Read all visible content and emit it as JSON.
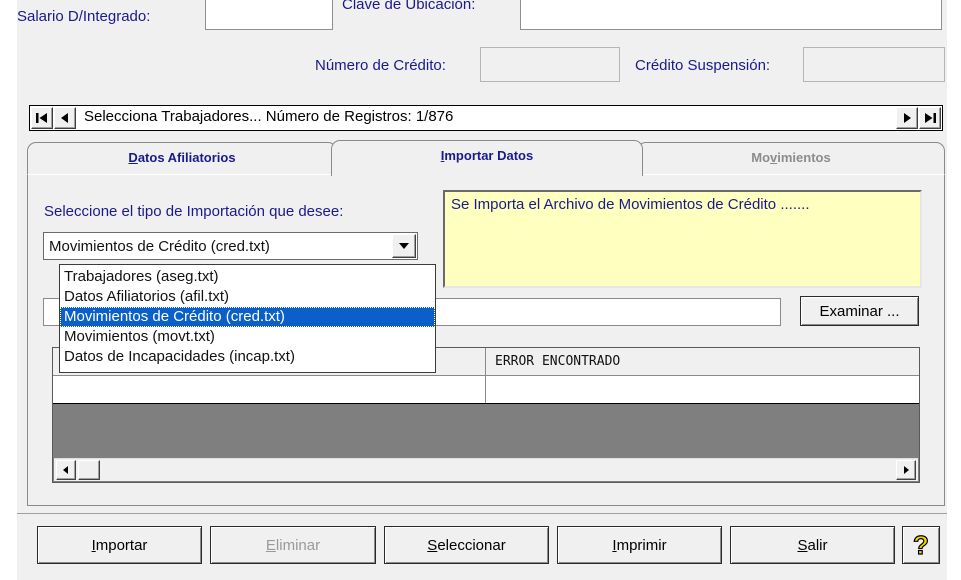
{
  "top_fields": {
    "salario_label": "Salario D/Integrado:",
    "clave_label": "Clave de Ubicación:",
    "numero_credito_label": "Número de Crédito:",
    "credito_suspension_label": "Crédito Suspensión:"
  },
  "navigator": {
    "text": "Selecciona Trabajadores... Número de Registros:  1/876",
    "first_icon": "first-record-icon",
    "prev_icon": "prev-record-icon",
    "next_icon": "next-record-icon",
    "last_icon": "last-record-icon"
  },
  "tabs": [
    {
      "pre": "",
      "ul": "D",
      "post": "atos Afiliatorios",
      "state": "normal"
    },
    {
      "pre": "",
      "ul": "I",
      "post": "mportar Datos",
      "state": "active"
    },
    {
      "pre": "Mo",
      "ul": "v",
      "post": "imientos",
      "state": "disabled"
    }
  ],
  "import_panel": {
    "prompt": "Seleccione el tipo de Importación que desee:",
    "selected_type": "Movimientos de Crédito (cred.txt)",
    "type_options": [
      "Trabajadores (aseg.txt)",
      "Datos Afiliatorios (afil.txt)",
      "Movimientos de Crédito (cred.txt)",
      "Movimientos (movt.txt)",
      "Datos de Incapacidades (incap.txt)"
    ],
    "selected_index": 2,
    "info_text": "Se Importa el Archivo de Movimientos de Crédito .......",
    "browse_label": "Examinar ...",
    "grid_header_error": "ERROR ENCONTRADO"
  },
  "buttons": [
    {
      "pre": "",
      "ul": "I",
      "post": "mportar",
      "enabled": true
    },
    {
      "pre": "",
      "ul": "E",
      "post": "liminar",
      "enabled": false
    },
    {
      "pre": "",
      "ul": "S",
      "post": "eleccionar",
      "enabled": true
    },
    {
      "pre": "",
      "ul": "I",
      "post": "mprimir",
      "enabled": true
    },
    {
      "pre": "",
      "ul": "S",
      "post": "alir",
      "enabled": true
    }
  ],
  "help_icon": "help-question-icon",
  "colors": {
    "label_blue": "#1a1a8c",
    "info_yellow": "#ffffc0",
    "selection_blue": "#0a5fc9",
    "grid_empty_gray": "#7f7f7f"
  }
}
